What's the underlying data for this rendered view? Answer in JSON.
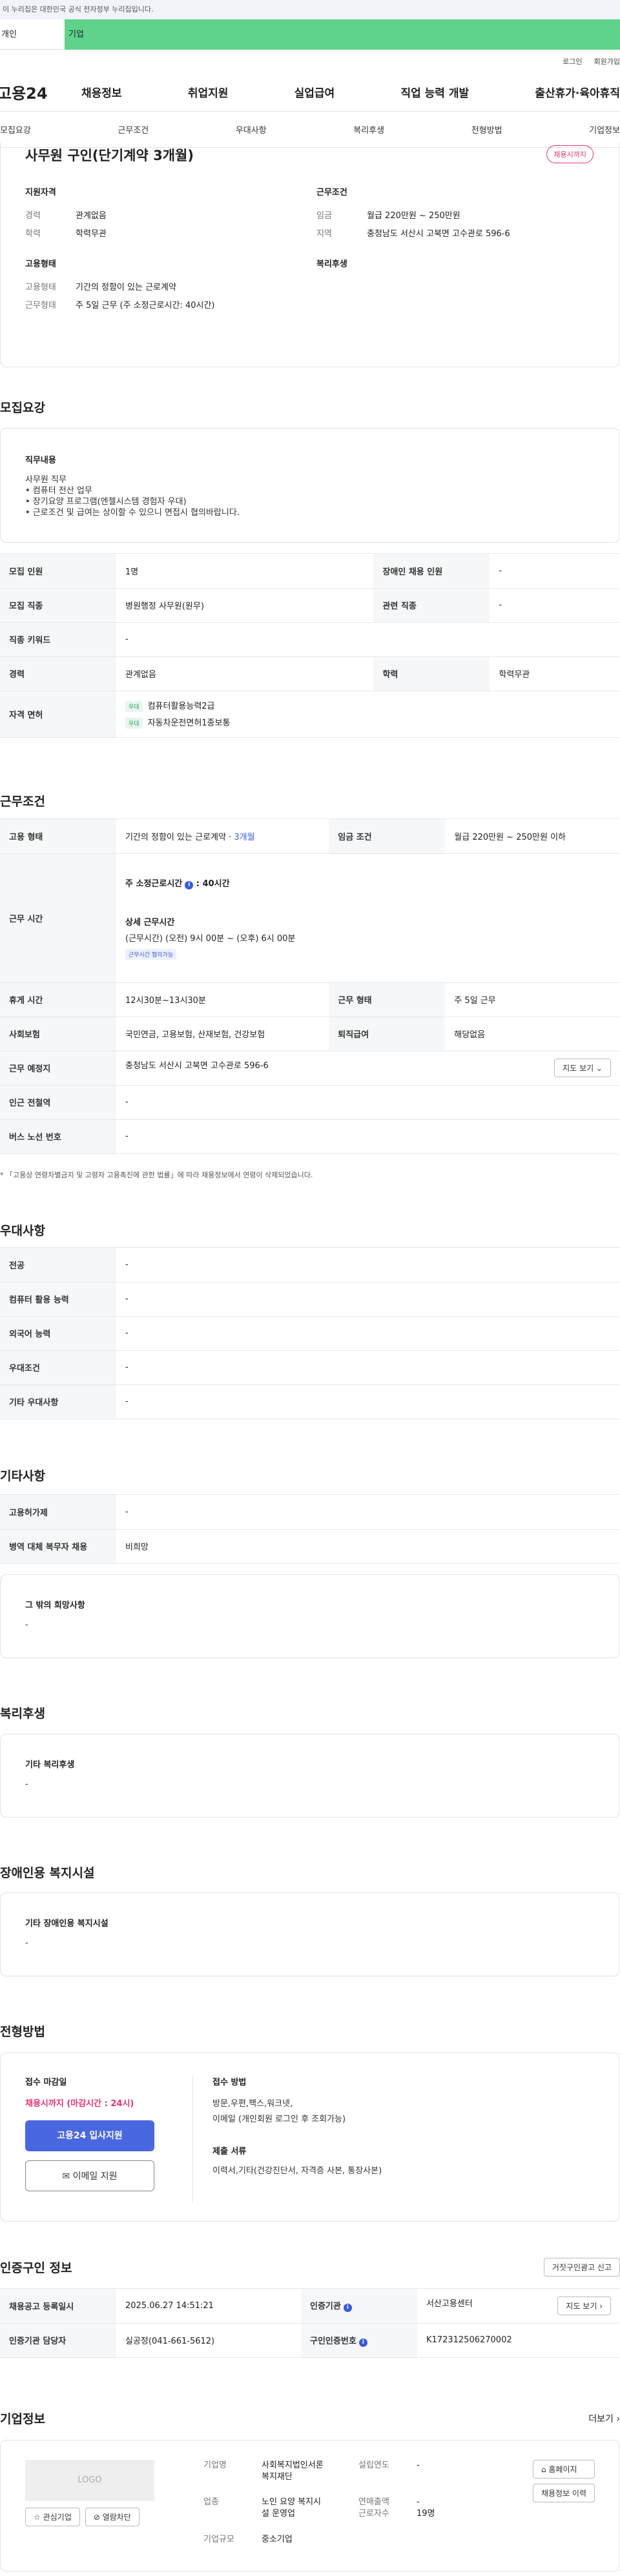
{
  "gov_banner": "이 누리집은 대한민국 공식 전자정부 누리집입니다.",
  "user_tabs": [
    "개인",
    "기업"
  ],
  "top_links": [
    "로그인",
    "회원가입"
  ],
  "logo": "고용24",
  "gnb": [
    "채용정보",
    "취업지원",
    "실업급여",
    "직업 능력 개발",
    "출산휴가·육아휴직"
  ],
  "subnav": [
    "모집요강",
    "근무조건",
    "우대사항",
    "복리후생",
    "전형방법",
    "기업정보"
  ],
  "summary": {
    "title": "사무원 구인(단기계약 3개월)",
    "badge": "채용시까지",
    "qual_title": "지원자격",
    "qual": [
      {
        "k": "경력",
        "v": "관계없음"
      },
      {
        "k": "학력",
        "v": "학력무관"
      }
    ],
    "cond_title": "근무조건",
    "cond": [
      {
        "k": "임금",
        "v": "월급 220만원 ~ 250만원"
      },
      {
        "k": "지역",
        "v": "충청남도 서산시 고북면 고수관로 596-6"
      }
    ],
    "emp_title": "고용형태",
    "emp": [
      {
        "k": "고용형태",
        "v": "기간의 정함이 있는 근로계약"
      },
      {
        "k": "근무형태",
        "v": "주 5일 근무 (주 소정근로시간: 40시간)"
      }
    ],
    "welfare_title": "복리후생"
  },
  "recruit": {
    "title": "모집요강",
    "duty_title": "직무내용",
    "duty_lines": [
      "사무원 직무",
      "• 컴퓨터 전산 업무",
      "• 장기요양 프로그램(엔젤시스템 경험자 우대)",
      "• 근로조건 및 급여는 상이할 수 있으니 면접시 협의바랍니다."
    ],
    "rows": {
      "r1": {
        "h1": "모집 인원",
        "v1": "1명",
        "h2": "장애인 채용 인원",
        "v2": "-"
      },
      "r2": {
        "h1": "모집 직종",
        "v1": "병원행정 사무원(원무)",
        "h2": "관련 직종",
        "v2": "-"
      },
      "r3": {
        "h1": "직종 키워드",
        "v1": "-"
      },
      "r4": {
        "h1": "경력",
        "v1": "관계없음",
        "h2": "학력",
        "v2": "학력무관"
      },
      "r5": {
        "h1": "자격 면허",
        "tag": "우대",
        "lic1": "컴퓨터활용능력2급",
        "lic2": "자동차운전면허1종보통"
      }
    }
  },
  "work": {
    "title": "근무조건",
    "emp_h": "고용 형태",
    "emp_v": "기간의 정함이 있는 근로계약 · ",
    "emp_v2": "3개월",
    "wage_h": "임금 조건",
    "wage_v": "월급 220만원 ~ 250만원 이하",
    "time_h": "근무 시간",
    "time_l1": "주 소정근로시간",
    "time_l1b": "40시간",
    "time_l2": "상세 근무시간",
    "time_l3": "(근무시간) (오전) 9시 00분 ~ (오후) 6시 00분",
    "time_tag": "근무시간 협의가능",
    "rest_h": "휴게 시간",
    "rest_v": "12시30분~13시30분",
    "form_h": "근무 형태",
    "form_v": "주 5일 근무",
    "ins_h": "사회보험",
    "ins_v": "국민연금, 고용보험, 산재보험, 건강보험",
    "ret_h": "퇴직급여",
    "ret_v": "해당없음",
    "place_h": "근무 예정지",
    "place_v": "충청남도 서산시 고북면 고수관로 596-6",
    "map_btn": "지도 보기 ⌄",
    "sub_h": "인근 전철역",
    "sub_v": "-",
    "bus_h": "버스 노선 번호",
    "bus_v": "-",
    "note": "* 「고용상 연령차별금지 및 고령자 고용촉진에 관한 법률」에 따라 채용정보에서 연령이 삭제되었습니다."
  },
  "pref": {
    "title": "우대사항",
    "rows": [
      {
        "h": "전공",
        "v": "-"
      },
      {
        "h": "컴퓨터 활용 능력",
        "v": "-"
      },
      {
        "h": "외국어 능력",
        "v": "-"
      },
      {
        "h": "우대조건",
        "v": "-"
      },
      {
        "h": "기타 우대사항",
        "v": "-"
      }
    ]
  },
  "etc": {
    "title": "기타사항",
    "rows": [
      {
        "h": "고용허가제",
        "v": "-"
      },
      {
        "h": "병역 대체 복무자 채용",
        "v": "비희망"
      }
    ],
    "other_title": "그 밖의 희망사항",
    "other_v": "-"
  },
  "welfare": {
    "title": "복리후생",
    "box_title": "기타 복리후생",
    "box_v": "-"
  },
  "disab": {
    "title": "장애인용 복지시설",
    "box_title": "기타 장애인용 복지시설",
    "box_v": "-"
  },
  "process": {
    "title": "전형방법",
    "deadline_t": "접수 마감일",
    "deadline_v": "채용시까지 (마감시간 : 24시)",
    "apply_btn": "고용24 입사지원",
    "email_btn": "✉ 이메일 지원",
    "method_t": "접수 방법",
    "method_v1": "방문,우편,팩스,워크넷,",
    "method_v2": "이메일 (개인회원 로그인 후 조회가능)",
    "docs_t": "제출 서류",
    "docs_v": "이력서,기타(건강진단서, 자격증 사본, 통장사본)"
  },
  "cert": {
    "title": "인증구인 정보",
    "report_btn": "거짓구인광고 신고",
    "reg_h": "채용공고 등록일시",
    "reg_v": "2025.06.27 14:51:21",
    "org_h": "인증기관",
    "org_v": "서산고용센터",
    "map_btn": "지도 보기 ›",
    "mgr_h": "인증기관 담당자",
    "mgr_v": "실공정(041-661-5612)",
    "no_h": "구인인증번호",
    "no_v": "K172312506270002"
  },
  "company": {
    "title": "기업정보",
    "more": "더보기 ›",
    "logo": "LOGO",
    "fav": "☆ 관심기업",
    "block": "⊘ 열람차단",
    "name_h": "기업명",
    "name_v1": "사회복지법인서론",
    "name_v2": "복지재단",
    "year_h": "설립연도",
    "year_v": "-",
    "ind_h": "업종",
    "ind_v1": "노인 요양 복지시",
    "ind_v2": "설 운영업",
    "sales_h": "연매출액",
    "sales_v": "-",
    "emp_h": "근로자수",
    "emp_v": "19명",
    "size_h": "기업규모",
    "size_v": "중소기업",
    "btn1": "⌂ 홈페이지",
    "btn2": "채용정보 이력"
  }
}
